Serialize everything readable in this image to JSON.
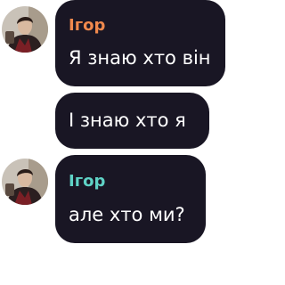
{
  "messages": [
    {
      "sender": "Ігор",
      "sender_color": "#f0894d",
      "text": "Я знаю хто він"
    },
    {
      "sender": "",
      "text": "І знаю хто я"
    },
    {
      "sender": "Ігор",
      "sender_color": "#5fd3c6",
      "text": "але хто ми?"
    }
  ],
  "colors": {
    "bubble": "#191624",
    "text": "#ffffff",
    "background": "#ffffff"
  },
  "icons": {
    "avatar": "user-photo-avatar"
  }
}
